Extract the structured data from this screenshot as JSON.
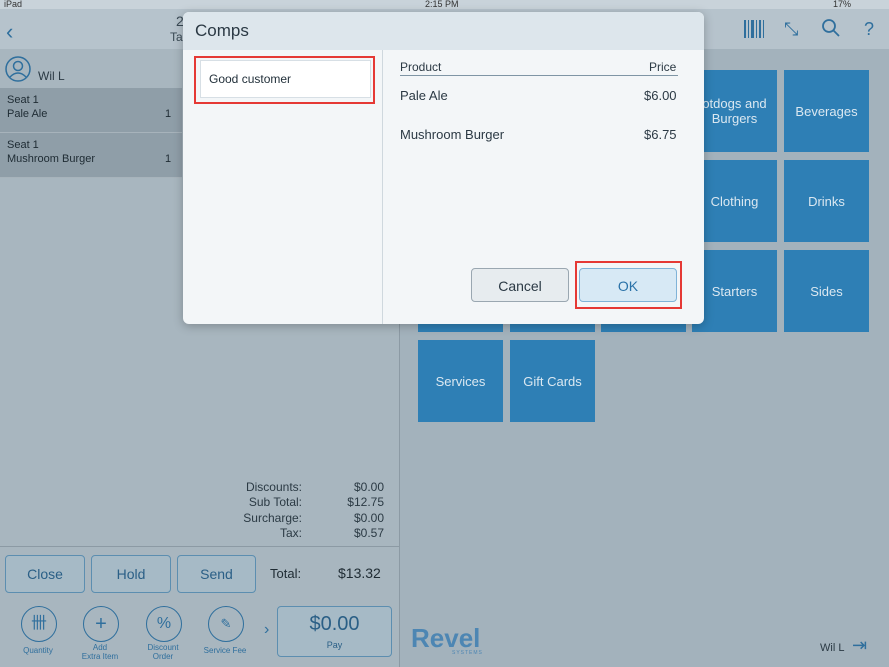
{
  "status_bar": {
    "device": "iPad",
    "time": "2:15 PM",
    "battery": "17%"
  },
  "header": {
    "table_number": "2",
    "table_label": "Ta"
  },
  "order": {
    "user": "Wil L",
    "items": [
      {
        "seat": "Seat 1",
        "name": "Pale Ale",
        "qty": "1"
      },
      {
        "seat": "Seat 1",
        "name": "Mushroom Burger",
        "qty": "1"
      }
    ],
    "totals": {
      "discounts_label": "Discounts:",
      "discounts": "$0.00",
      "subtotal_label": "Sub Total:",
      "subtotal": "$12.75",
      "surcharge_label": "Surcharge:",
      "surcharge": "$0.00",
      "tax_label": "Tax:",
      "tax": "$0.57",
      "total_label": "Total:",
      "total": "$13.32"
    },
    "buttons": {
      "close": "Close",
      "hold": "Hold",
      "send": "Send"
    },
    "tools": {
      "quantity": "Quantity",
      "add_extra_1": "Add",
      "add_extra_2": "Extra Item",
      "discount_1": "Discount",
      "discount_2": "Order",
      "service_fee": "Service Fee"
    },
    "pay": {
      "amount": "$0.00",
      "label": "Pay"
    }
  },
  "categories": [
    {
      "label": "otdogs and Burgers"
    },
    {
      "label": "Beverages"
    },
    {
      "label": "Clothing"
    },
    {
      "label": "Drinks"
    },
    {
      "label": "Starters"
    },
    {
      "label": "Sides"
    },
    {
      "label": "Services"
    },
    {
      "label": "Gift Cards"
    }
  ],
  "brand": {
    "logo": "Revel",
    "sub": "SYSTEMS"
  },
  "footer_user": "Wil L",
  "modal": {
    "title": "Comps",
    "reason": "Good customer",
    "col_product": "Product",
    "col_price": "Price",
    "rows": [
      {
        "product": "Pale Ale",
        "price": "$6.00"
      },
      {
        "product": "Mushroom Burger",
        "price": "$6.75"
      }
    ],
    "cancel": "Cancel",
    "ok": "OK"
  },
  "colors": {
    "accent": "#2e7fb5",
    "highlight": "#e53935"
  }
}
